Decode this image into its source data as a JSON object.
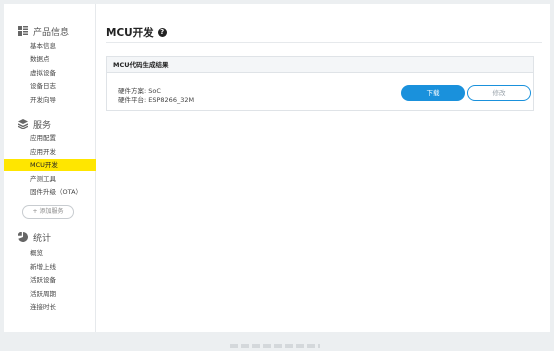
{
  "sidebar": {
    "groups": [
      {
        "title": "产品信息",
        "icon": "grid-icon",
        "items": [
          {
            "label": "基本信息"
          },
          {
            "label": "数据点"
          },
          {
            "label": "虚拟设备"
          },
          {
            "label": "设备日志"
          },
          {
            "label": "开发向导"
          }
        ]
      },
      {
        "title": "服务",
        "icon": "layers-icon",
        "items": [
          {
            "label": "应用配置"
          },
          {
            "label": "应用开发"
          },
          {
            "label": "MCU开发",
            "active": true
          },
          {
            "label": "产测工具"
          },
          {
            "label": "固件升级（OTA）"
          }
        ],
        "add_button": "+ 添加服务"
      },
      {
        "title": "统计",
        "icon": "pie-chart-icon",
        "items": [
          {
            "label": "概览"
          },
          {
            "label": "新增上线"
          },
          {
            "label": "活跃设备"
          },
          {
            "label": "活跃周期"
          },
          {
            "label": "连接时长"
          }
        ]
      }
    ]
  },
  "main": {
    "title": "MCU开发",
    "help_icon": "?",
    "card": {
      "title": "MCU代码生成结果",
      "lines": [
        "硬件方案: SoC",
        "硬件平台: ESP8266_32M"
      ],
      "primary_button": "下载",
      "secondary_button": "修改"
    }
  },
  "colors": {
    "active_highlight": "#ffe600",
    "primary": "#1a91dc",
    "page_background": "#eceff1"
  }
}
